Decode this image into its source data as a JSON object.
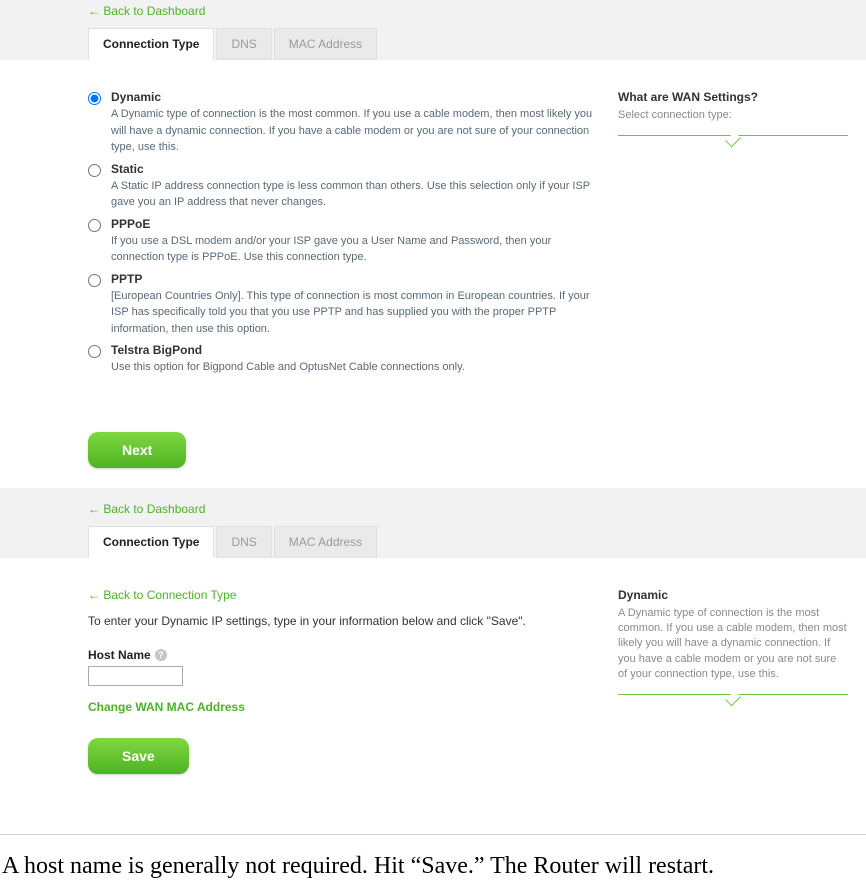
{
  "screen1": {
    "back_link": "← Back to Dashboard",
    "tabs": [
      "Connection Type",
      "DNS",
      "MAC Address"
    ],
    "options": [
      {
        "title": "Dynamic",
        "desc": "A Dynamic type of connection is the most common. If you use a cable modem, then most likely you will have a dynamic connection. If you have a cable modem or you are not sure of your connection type, use this."
      },
      {
        "title": "Static",
        "desc": "A Static IP address connection type is less common than others. Use this selection only if your ISP gave you an IP address that never changes."
      },
      {
        "title": "PPPoE",
        "desc": "If you use a DSL modem and/or your ISP gave you a User Name and Password, then your connection type is PPPoE. Use this connection type."
      },
      {
        "title": "PPTP",
        "desc": "[European Countries Only]. This type of connection is most common in European countries. If your ISP has specifically told you that you use PPTP and has supplied you with the proper PPTP information, then use this option."
      },
      {
        "title": "Telstra BigPond",
        "desc": "Use this option for Bigpond Cable and OptusNet Cable connections only."
      }
    ],
    "sidebar": {
      "title": "What are WAN Settings?",
      "text": "Select connection type:"
    },
    "next_btn": "Next"
  },
  "screen2": {
    "back_link": "← Back to Dashboard",
    "tabs": [
      "Connection Type",
      "DNS",
      "MAC Address"
    ],
    "sub_back": "← Back to Connection Type",
    "instr": "To enter your Dynamic IP settings, type in your information below and click \"Save\".",
    "host_label": "Host Name",
    "host_value": "",
    "change_link": "Change WAN MAC Address",
    "save_btn": "Save",
    "sidebar": {
      "title": "Dynamic",
      "text": "A Dynamic type of connection is the most common. If you use a cable modem, then most likely you will have a dynamic connection. If you have a cable modem or you are not sure of your connection type, use this."
    }
  },
  "caption": "A host name is generally not required. Hit “Save.” The Router will restart."
}
